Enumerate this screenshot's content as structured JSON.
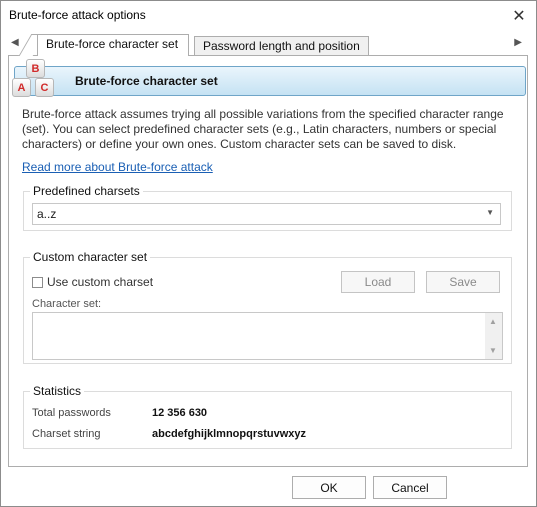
{
  "window": {
    "title": "Brute-force attack options"
  },
  "tabs": [
    {
      "label": "Brute-force character set",
      "active": true
    },
    {
      "label": "Password length and position",
      "active": false
    }
  ],
  "header": {
    "title": "Brute-force character set",
    "icon_letters": {
      "top": "B",
      "left": "A",
      "right": "C"
    }
  },
  "description": "Brute-force attack assumes trying all possible variations from the specified character range (set). You can select predefined character sets (e.g., Latin characters, numbers or special characters) or define your own ones. Custom character sets can be saved to disk.",
  "read_more_link": "Read more about Brute-force attack",
  "predefined": {
    "label": "Predefined charsets",
    "selected": "a..z"
  },
  "custom": {
    "label": "Custom character set",
    "use_custom_label": "Use custom charset",
    "use_custom_checked": false,
    "load_label": "Load",
    "save_label": "Save",
    "charset_label": "Character set:",
    "charset_value": ""
  },
  "statistics": {
    "label": "Statistics",
    "total_passwords_label": "Total passwords",
    "total_passwords_value": "12 356 630",
    "charset_string_label": "Charset string",
    "charset_string_value": "abcdefghijklmnopqrstuvwxyz"
  },
  "buttons": {
    "ok": "OK",
    "cancel": "Cancel"
  }
}
